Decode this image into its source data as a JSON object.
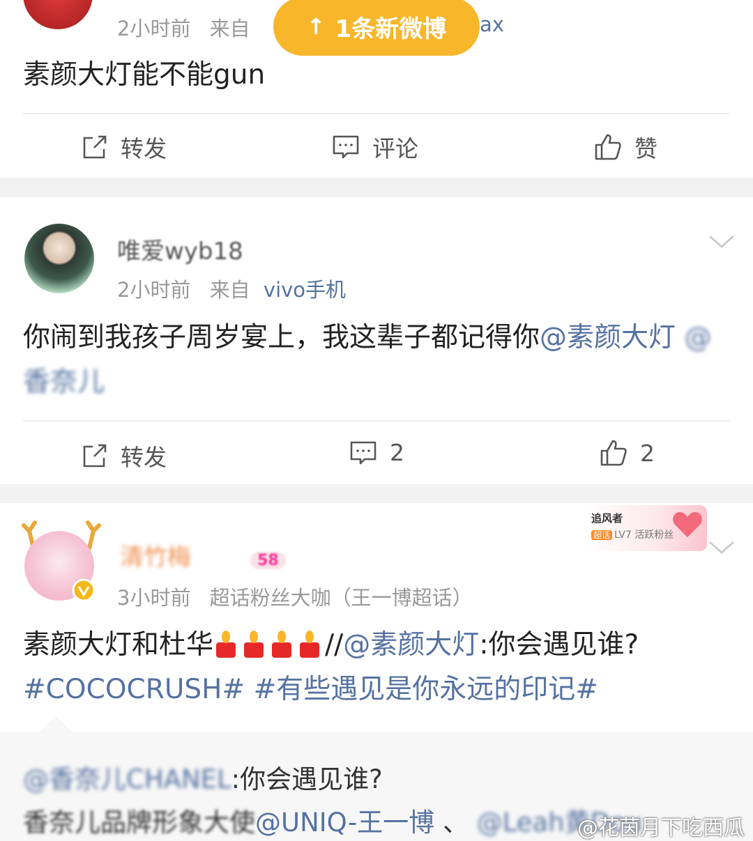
{
  "new_posts_pill": {
    "label": "1条新微博"
  },
  "post1": {
    "time": "2小时前",
    "from_label": "来自",
    "source_fragment": "lax",
    "text": "素颜大灯能不能gun",
    "actions": {
      "repost": "转发",
      "comment": "评论",
      "like": "赞"
    }
  },
  "post2": {
    "username": "唯爱wyb18",
    "time": "2小时前",
    "from_label": "来自",
    "source": "vivo手机",
    "text_plain": "你闹到我孩子周岁宴上，我这辈子都记得你",
    "mention1": "@素颜大灯",
    "mention2": "@香奈儿",
    "actions": {
      "repost": "转发",
      "comment_count": "2",
      "like_count": "2"
    }
  },
  "post3": {
    "username": "清竹梅",
    "level_tag": "58",
    "badge": {
      "title": "追风者",
      "tag": "超话",
      "level": "LV7 活跃粉丝"
    },
    "time": "3小时前",
    "source": "超话粉丝大咖（王一博超话）",
    "text_plain": "素颜大灯和杜华",
    "separator": "//",
    "mention": "@素颜大灯",
    "quote": ":你会遇见谁?",
    "hashtag1": "#COCOCRUSH#",
    "hashtag2": "#有些遇见是你永远的印记#"
  },
  "repost": {
    "author": "@香奈儿CHANEL",
    "text": ":你会遇见谁?",
    "line2_prefix": "香奈儿品牌形象大使",
    "line2_mention1": "@UNIQ-王一博",
    "line2_sep": "、",
    "line2_mention2": "@Leah黄Dou"
  },
  "watermark": "@花茵月下吃西瓜",
  "colors": {
    "link": "#5572a1",
    "pill": "#f8b62a",
    "meta": "#999999"
  }
}
